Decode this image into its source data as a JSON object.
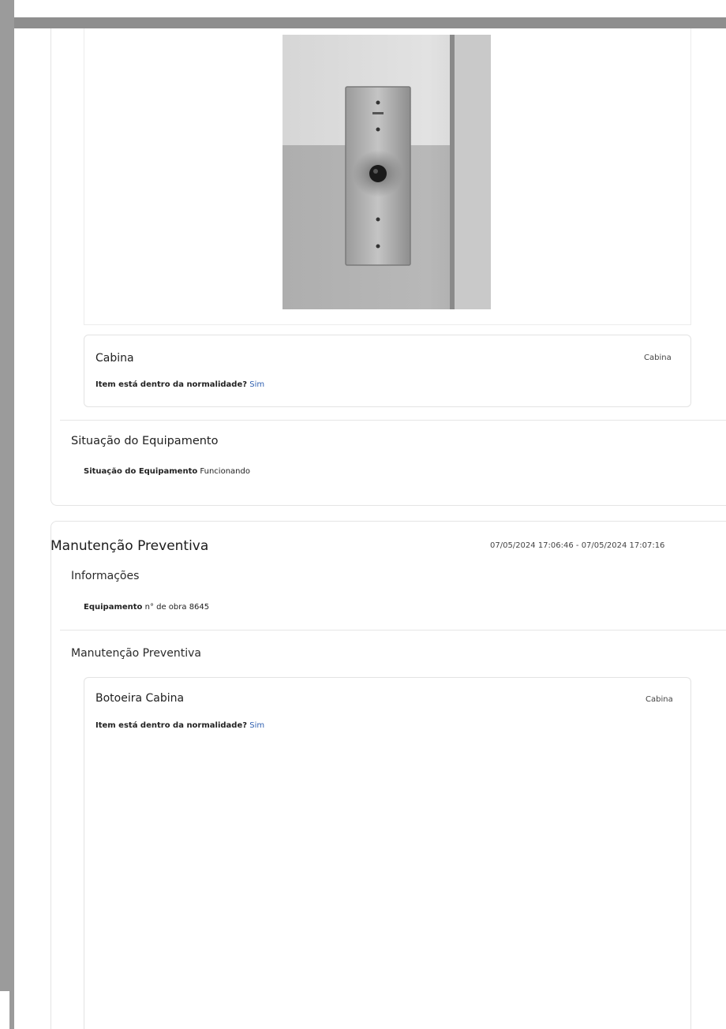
{
  "cabina_item": {
    "title": "Cabina",
    "tag": "Cabina",
    "question": "Item está dentro da normalidade?",
    "answer": "Sim"
  },
  "situacao": {
    "section_title": "Situação do Equipamento",
    "label": "Situação do Equipamento",
    "value": "Funcionando"
  },
  "preventiva_card": {
    "heading": "Manutenção Preventiva",
    "timestamp": "07/05/2024 17:06:46 - 07/05/2024 17:07:16",
    "informacoes_title": "Informações",
    "equipamento_label": "Equipamento",
    "equipamento_value": "n° de obra 8645",
    "subsection_title": "Manutenção Preventiva",
    "item": {
      "title": "Botoeira Cabina",
      "tag": "Cabina",
      "question": "Item está dentro da normalidade?",
      "answer": "Sim"
    }
  },
  "icons": [
    "elevator-call-button-photo"
  ],
  "colors": {
    "link": "#2f5fb0",
    "frame_gray": "#9b9b9b"
  }
}
